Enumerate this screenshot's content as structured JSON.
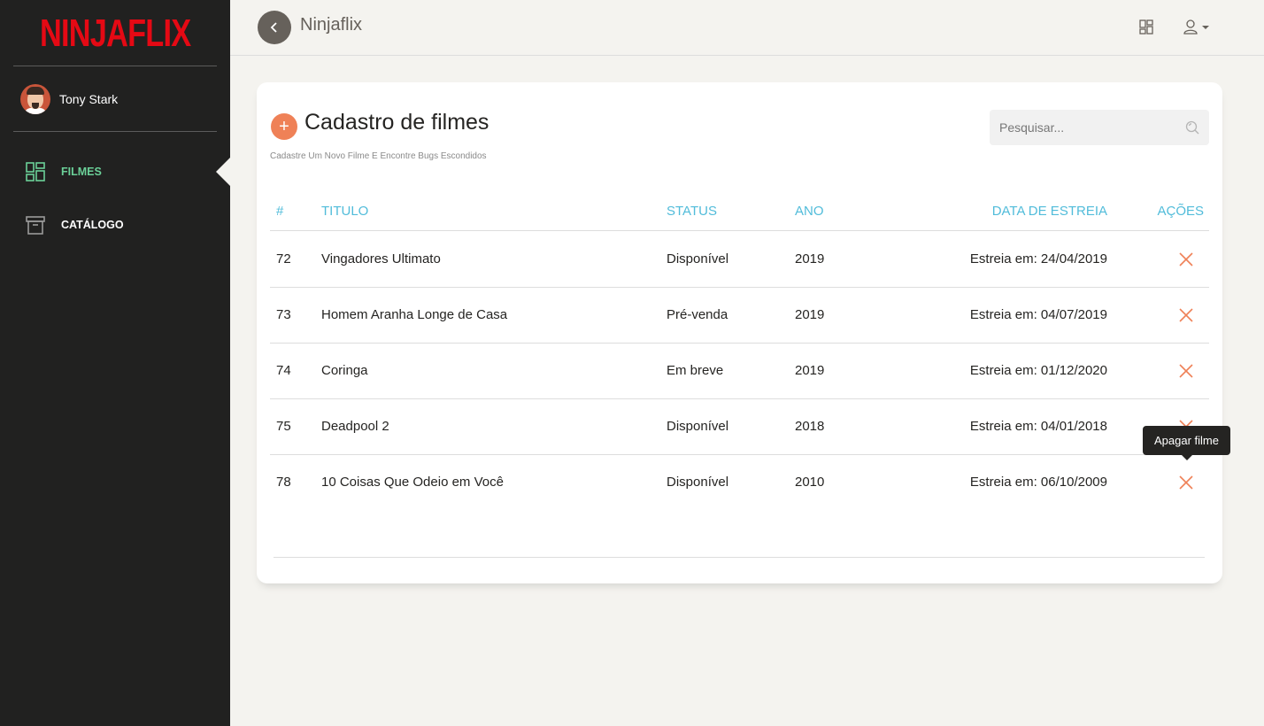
{
  "sidebar": {
    "logo_text": "NINJAFLIX",
    "user_name": "Tony Stark",
    "items": [
      {
        "label": "FILMES",
        "icon": "dashboard-icon",
        "active": true
      },
      {
        "label": "CATÁLOGO",
        "icon": "archive-icon",
        "active": false
      }
    ]
  },
  "topbar": {
    "brand": "Ninjaflix",
    "icons": [
      "dashboard-icon",
      "user-icon"
    ]
  },
  "page": {
    "title": "Cadastro de filmes",
    "subtitle": "Cadastre Um Novo Filme E Encontre Bugs Escondidos",
    "add_label": "+",
    "search_placeholder": "Pesquisar..."
  },
  "table": {
    "headers": [
      "#",
      "TITULO",
      "STATUS",
      "ANO",
      "DATA DE ESTREIA",
      "AÇÕES"
    ],
    "rows": [
      {
        "id": "72",
        "title": "Vingadores Ultimato",
        "status": "Disponível",
        "year": "2019",
        "release": "Estreia em: 24/04/2019"
      },
      {
        "id": "73",
        "title": "Homem Aranha Longe de Casa",
        "status": "Pré-venda",
        "year": "2019",
        "release": "Estreia em: 04/07/2019"
      },
      {
        "id": "74",
        "title": "Coringa",
        "status": "Em breve",
        "year": "2019",
        "release": "Estreia em: 01/12/2020"
      },
      {
        "id": "75",
        "title": "Deadpool 2",
        "status": "Disponível",
        "year": "2018",
        "release": "Estreia em: 04/01/2018"
      },
      {
        "id": "78",
        "title": "10 Coisas Que Odeio em Você",
        "status": "Disponível",
        "year": "2010",
        "release": "Estreia em: 06/10/2009"
      }
    ]
  },
  "tooltip": "Apagar filme",
  "colors": {
    "accent_green": "#6bd098",
    "header_blue": "#51bcda",
    "delete_orange": "#ef8157",
    "sidebar_bg": "#212120",
    "logo_red": "#e50914"
  }
}
